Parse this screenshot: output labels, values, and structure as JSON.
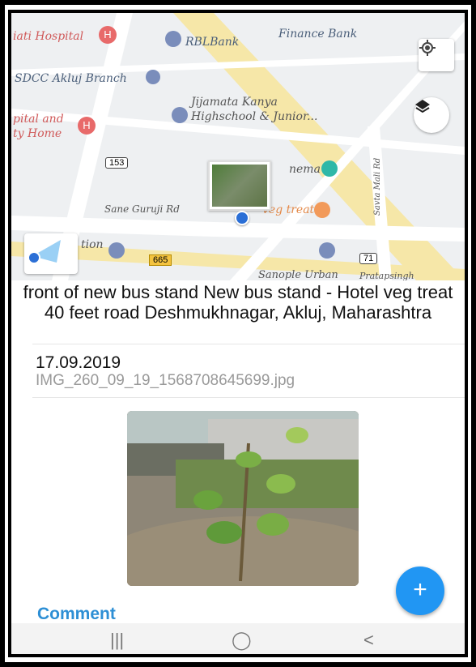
{
  "map": {
    "pois": [
      {
        "name": "hospital-label-1",
        "text": "iati Hospital"
      },
      {
        "name": "bank-label-rbl",
        "text": "RBLBank"
      },
      {
        "name": "bank-label-finance",
        "text": "Finance Bank"
      },
      {
        "name": "bank-label-sdcc",
        "text": "SDCC Akluj Branch"
      },
      {
        "name": "school-label-line1",
        "text": "Jijamata Kanya"
      },
      {
        "name": "school-label-line2",
        "text": "Highschool & Junior..."
      },
      {
        "name": "hospital-label-2-line1",
        "text": "pital and"
      },
      {
        "name": "hospital-label-2-line2",
        "text": "ty Home"
      },
      {
        "name": "cinema-label",
        "text": "nema"
      },
      {
        "name": "road-label-sane-guruji",
        "text": "Sane Guruji Rd"
      },
      {
        "name": "restaurant-label",
        "text": "veg treat"
      },
      {
        "name": "station-label",
        "text": "tion"
      },
      {
        "name": "road-label-savta-mali",
        "text": "Savta Mali Rd"
      },
      {
        "name": "sanople-label",
        "text": "Sanople Urban"
      },
      {
        "name": "pratapsingh-label",
        "text": "Pratapsingh"
      }
    ],
    "highway_shields": {
      "h153": "153",
      "h665": "665",
      "h71": "71"
    }
  },
  "details": {
    "address": "front of new bus stand New bus stand - Hotel veg treat 40 feet road Deshmukhnagar, Akluj, Maharashtra",
    "date": "17.09.2019",
    "filename": "IMG_260_09_19_1568708645699.jpg",
    "comment_label": "Comment",
    "fab_label": "+"
  },
  "navbar": {
    "recents": "|||",
    "home": "◯",
    "back": "<"
  },
  "colors": {
    "accent": "#2196f3",
    "comment_text": "#2d8fd5",
    "map_background": "#eef0f2",
    "road_yellow": "#f6e7a8"
  }
}
